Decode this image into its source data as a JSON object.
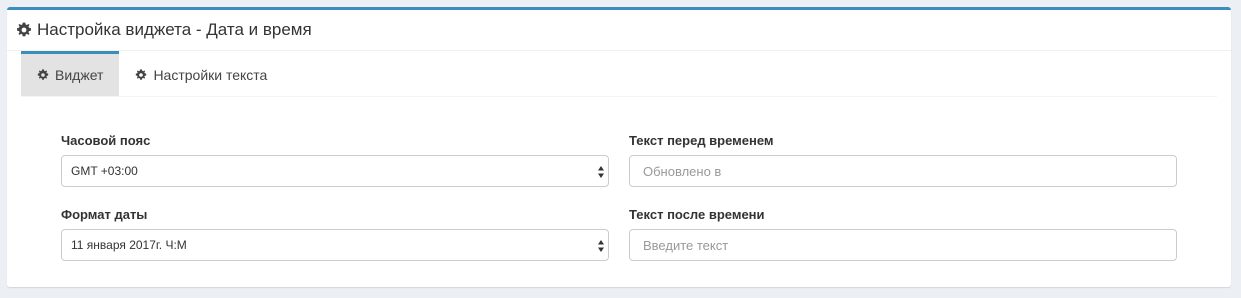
{
  "panel": {
    "title": "Настройка виджета - Дата и время"
  },
  "tabs": [
    {
      "label": "Виджет",
      "active": true
    },
    {
      "label": "Настройки текста",
      "active": false
    }
  ],
  "form": {
    "timezone": {
      "label": "Часовой пояс",
      "value": "GMT +03:00"
    },
    "date_format": {
      "label": "Формат даты",
      "value": "11 января 2017г. Ч:М"
    },
    "text_before": {
      "label": "Текст перед временем",
      "placeholder": "Обновлено в"
    },
    "text_after": {
      "label": "Текст после времени",
      "placeholder": "Введите текст"
    }
  },
  "colors": {
    "accent": "#3c8dbc",
    "background": "#ecf0f5",
    "active_tab": "#e3e3e3"
  },
  "icons": {
    "header": "gear-icon",
    "tab": "gear-icon",
    "select": "sort-arrows-icon"
  }
}
